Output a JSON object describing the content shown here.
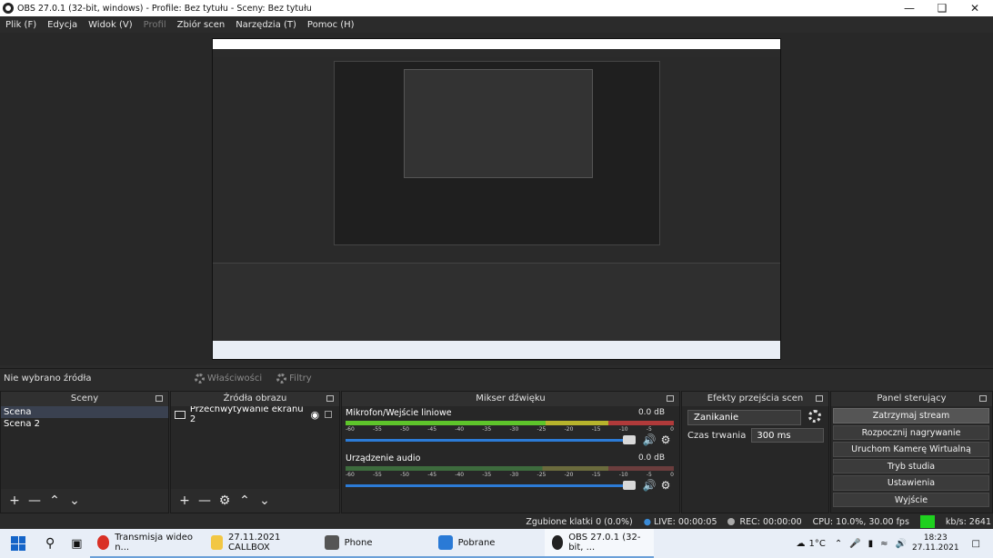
{
  "window": {
    "title": "OBS 27.0.1 (32-bit, windows) - Profile: Bez tytułu - Sceny: Bez tytułu"
  },
  "menu": [
    {
      "label": "Plik (F)",
      "disabled": false
    },
    {
      "label": "Edycja",
      "disabled": false
    },
    {
      "label": "Widok (V)",
      "disabled": false
    },
    {
      "label": "Profil",
      "disabled": true
    },
    {
      "label": "Zbiór scen",
      "disabled": false
    },
    {
      "label": "Narzędzia (T)",
      "disabled": false
    },
    {
      "label": "Pomoc (H)",
      "disabled": false
    }
  ],
  "source_toolbar": {
    "no_source": "Nie wybrano źródła",
    "properties": "Właściwości",
    "filters": "Filtry"
  },
  "scenes": {
    "title": "Sceny",
    "items": [
      "Scena",
      "Scena 2"
    ],
    "selected": 0
  },
  "sources": {
    "title": "Źródła obrazu",
    "items": [
      "Przechwytywanie ekranu 2"
    ]
  },
  "mixer": {
    "title": "Mikser dźwięku",
    "channels": [
      {
        "name": "Mikrofon/Wejście liniowe",
        "db": "0.0 dB"
      },
      {
        "name": "Urządzenie audio",
        "db": "0.0 dB"
      }
    ],
    "ticks": [
      "-60",
      "-55",
      "-50",
      "-45",
      "-40",
      "-35",
      "-30",
      "-25",
      "-20",
      "-15",
      "-10",
      "-5",
      "0"
    ]
  },
  "transitions": {
    "title": "Efekty przejścia scen",
    "selected": "Zanikanie",
    "duration_label": "Czas trwania",
    "duration_value": "300 ms"
  },
  "controls": {
    "title": "Panel sterujący",
    "buttons": [
      "Zatrzymaj stream",
      "Rozpocznij nagrywanie",
      "Uruchom Kamerę Wirtualną",
      "Tryb studia",
      "Ustawienia",
      "Wyjście"
    ],
    "active": 0
  },
  "status": {
    "dropped": "Zgubione klatki 0 (0.0%)",
    "live": "LIVE: 00:00:05",
    "rec": "REC: 00:00:00",
    "cpu": "CPU: 10.0%, 30.00 fps",
    "kbs": "kb/s: 2641"
  },
  "taskbar": {
    "apps": [
      {
        "label": "Transmisja wideo n...",
        "color": "#d93025"
      },
      {
        "label": "27.11.2021 CALLBOX",
        "color": "#f2c744"
      },
      {
        "label": "Phone",
        "color": "#555555"
      },
      {
        "label": "Pobrane",
        "color": "#2a7ad6"
      },
      {
        "label": "OBS 27.0.1 (32-bit, ...",
        "color": "#222222"
      }
    ],
    "weather": "1°C",
    "time": "18:23",
    "date": "27.11.2021"
  }
}
